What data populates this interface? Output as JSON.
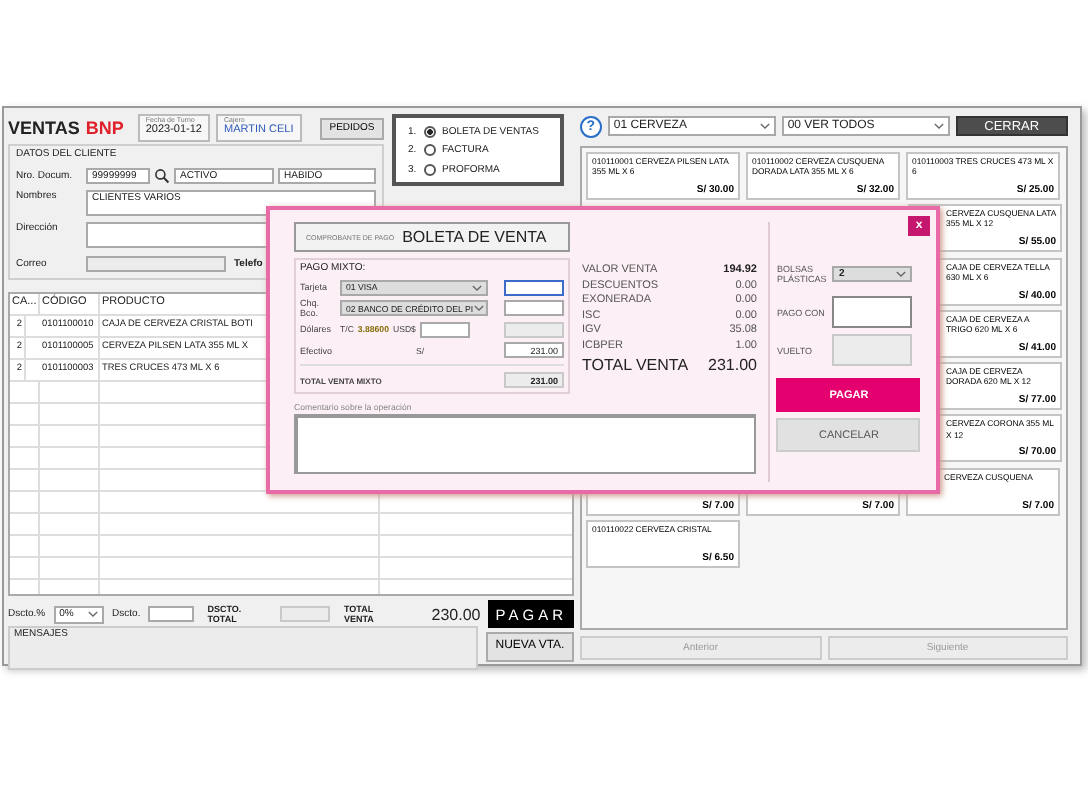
{
  "header": {
    "title": "VENTAS",
    "brand": "BNP",
    "shift_date": {
      "label": "Fecha de Turno",
      "value": "2023-01-12"
    },
    "cashier": {
      "label": "Cajero",
      "value": "MARTIN CELI"
    },
    "orders_button": "PEDIDOS"
  },
  "client": {
    "title": "DATOS DEL CLIENTE",
    "doc": {
      "label": "Nro. Docum.",
      "value": "99999999"
    },
    "status": "ACTIVO",
    "condition": "HABIDO",
    "name": {
      "label": "Nombres",
      "value": "CLIENTES VARIOS"
    },
    "address": {
      "label": "Dirección"
    },
    "email": {
      "label": "Correo"
    },
    "phone": {
      "label": "Telefo"
    }
  },
  "doc_types": [
    {
      "number": "1.",
      "label": "BOLETA DE VENTAS",
      "selected": true
    },
    {
      "number": "2.",
      "label": "FACTURA",
      "selected": false
    },
    {
      "number": "3.",
      "label": "PROFORMA",
      "selected": false
    }
  ],
  "table": {
    "columns": [
      "CA...",
      "CÓDIGO",
      "PRODUCTO"
    ],
    "rows": [
      [
        "2",
        "0101100010",
        "CAJA DE CERVEZA CRISTAL BOTI"
      ],
      [
        "2",
        "0101100005",
        "CERVEZA PILSEN LATA 355 ML X"
      ],
      [
        "2",
        "0101100003",
        "TRES CRUCES 473 ML X 6"
      ]
    ]
  },
  "footer": {
    "discount_pct": {
      "label": "Dscto.%",
      "value": "0%"
    },
    "discount": {
      "label": "Dscto."
    },
    "discount_total": {
      "label": "DSCTO. TOTAL"
    },
    "total": {
      "label": "TOTAL VENTA",
      "value": "230.00"
    },
    "pay_button": "PAGAR",
    "messages_label": "MENSAJES",
    "new_sale_button": "NUEVA VTA."
  },
  "catalog": {
    "help_icon": "?",
    "category": "01 CERVEZA",
    "filter": "00 VER TODOS",
    "close_button": "CERRAR",
    "product_rows": [
      [
        {
          "text": "010110001 CERVEZA PILSEN LATA 355 ML X 6",
          "price": "S/ 30.00"
        },
        {
          "text": "010110002 CERVEZA CUSQUENA DORADA LATA 355 ML X 6",
          "price": "S/ 32.00"
        },
        {
          "text": "010110003 TRES CRUCES 473 ML X 6",
          "price": "S/ 25.00"
        }
      ],
      [
        {
          "text": "CERVEZA CUSQUENA LATA 355 ML X 12",
          "price": "S/ 55.00"
        }
      ],
      [
        {
          "text": "CAJA DE CERVEZA TELLA 630 ML X 6",
          "price": "S/ 40.00"
        }
      ],
      [
        {
          "text": "CAJA DE CERVEZA A TRIGO 620 ML X 6",
          "price": "S/ 41.00"
        }
      ],
      [
        {
          "text": "CAJA DE CERVEZA DORADA 620 ML X 12",
          "price": "S/ 77.00"
        }
      ],
      [
        {
          "text": "CERVEZA CORONA 355 ML X 12",
          "price": "S/ 70.00"
        }
      ],
      [
        {
          "price": "S/ 7.00"
        },
        {
          "price": "S/ 7.00"
        },
        {
          "text": "CERVEZA CUSQUENA",
          "price": "S/ 7.00"
        }
      ],
      [
        {
          "text": "010110022 CERVEZA CRISTAL",
          "price": "S/ 6.50"
        }
      ]
    ],
    "prev_button": {
      "label": "Anterior",
      "disabled": true
    },
    "next_button": {
      "label": "Siguiente",
      "disabled": true
    }
  },
  "payment_dialog": {
    "close": "x",
    "voucher_label": "COMPROBANTE DE PAGO",
    "voucher_type": "BOLETA DE VENTA",
    "mixed": {
      "title": "PAGO MIXTO:",
      "card": {
        "label": "Tarjeta",
        "option": "01 VISA"
      },
      "check": {
        "label": "Chq. Bco.",
        "option": "02 BANCO DE CRÉDITO DEL PI"
      },
      "dollars": {
        "label": "Dólares",
        "rate_label": "T/C",
        "rate": "3.88600",
        "usd_label": "USD$"
      },
      "cash": {
        "label": "Efectivo",
        "currency": "S/",
        "value": "231.00"
      },
      "total": {
        "label": "TOTAL VENTA MIXTO",
        "value": "231.00"
      }
    },
    "summary": [
      {
        "label": "VALOR VENTA",
        "value": "194.92",
        "kind": "emphasis"
      },
      {
        "label": "DESCUENTOS",
        "value": "0.00",
        "kind": "normal"
      },
      {
        "label": "EXONERADA",
        "value": "0.00",
        "kind": "normal"
      },
      {
        "label": "ISC",
        "value": "0.00",
        "kind": "normal"
      },
      {
        "label": "IGV",
        "value": "35.08",
        "kind": "normal"
      },
      {
        "label": "ICBPER",
        "value": "1.00",
        "kind": "normal"
      },
      {
        "label": "TOTAL VENTA",
        "value": "231.00",
        "kind": "total"
      }
    ],
    "bags": {
      "label": "BOLSAS PLÁSTICAS",
      "value": "2"
    },
    "pay_with": {
      "label": "PAGO CON"
    },
    "change": {
      "label": "VUELTO"
    },
    "pay_button": "PAGAR",
    "cancel_button": "CANCELAR",
    "comment": {
      "label": "Comentario sobre la operación"
    }
  }
}
